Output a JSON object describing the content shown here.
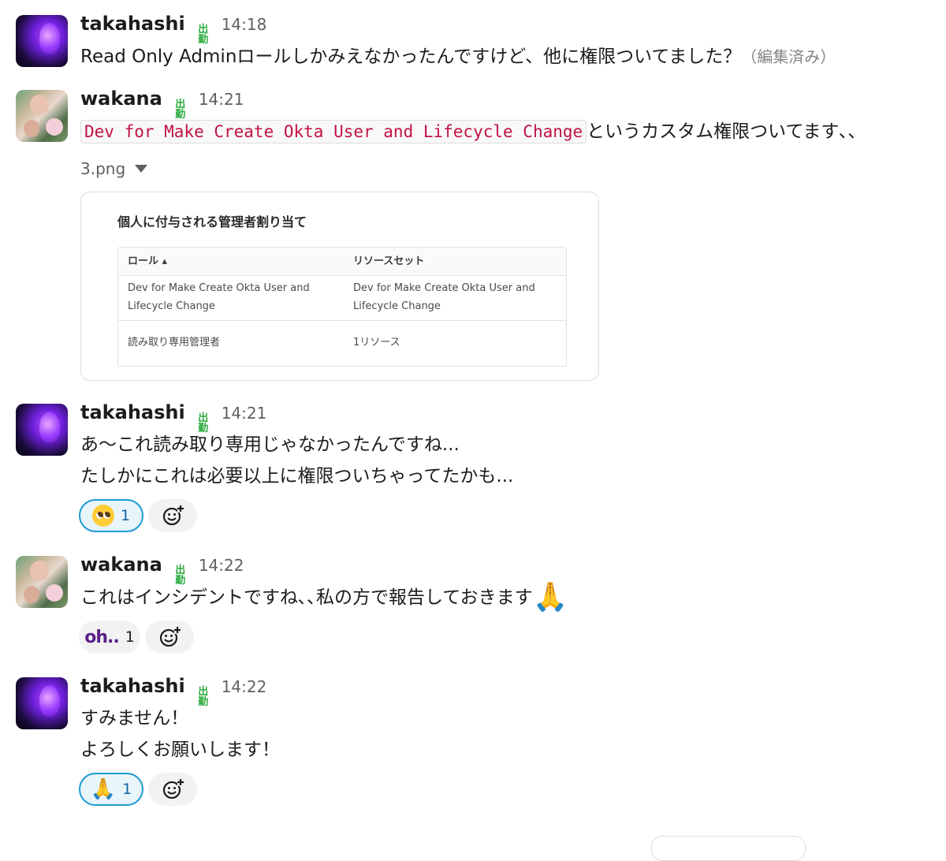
{
  "messages": [
    {
      "user": "takahashi",
      "status_icon": "出勤",
      "time": "14:18",
      "text": "Read Only Adminロールしかみえなかったんですけど、他に権限ついてました？",
      "edited": "（編集済み）"
    },
    {
      "user": "wakana",
      "status_icon": "出勤",
      "time": "14:21",
      "code": "Dev for Make Create Okta User and Lifecycle Change",
      "text_after_code": "というカスタム権限ついてます､､",
      "file": {
        "name": "3.png",
        "preview_title": "個人に付与される管理者割り当て",
        "table_headers": [
          "ロール ▴",
          "リソースセット"
        ],
        "rows": [
          [
            "Dev for Make Create Okta User and",
            "Dev for Make Create Okta User and"
          ],
          [
            "Lifecycle Change",
            "Lifecycle Change"
          ],
          [
            "読み取り専用管理者",
            "1リソース"
          ]
        ]
      }
    },
    {
      "user": "takahashi",
      "status_icon": "出勤",
      "time": "14:21",
      "lines": [
        "あ〜これ読み取り専用じゃなかったんですね...",
        "たしかにこれは必要以上に権限ついちゃってたかも..."
      ],
      "reactions": [
        {
          "emoji": "pleading-face",
          "count": "1"
        }
      ]
    },
    {
      "user": "wakana",
      "status_icon": "出勤",
      "time": "14:22",
      "text": "これはインシデントですね､､私の方で報告しておきます",
      "reactions": [
        {
          "emoji": "oh..",
          "count": "1"
        }
      ]
    },
    {
      "user": "takahashi",
      "status_icon": "出勤",
      "time": "14:22",
      "lines": [
        "すみません！",
        "よろしくお願いします！"
      ],
      "reactions": [
        {
          "emoji": "folded-hands",
          "count": "1"
        }
      ]
    }
  ]
}
